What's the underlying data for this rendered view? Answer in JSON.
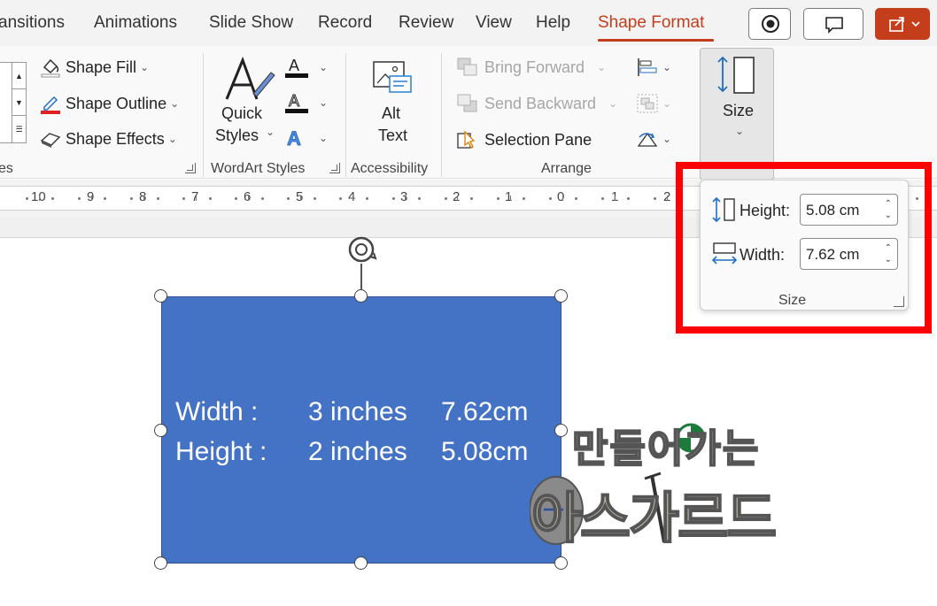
{
  "tabs": [
    {
      "label": "ansitions"
    },
    {
      "label": "Animations"
    },
    {
      "label": "Slide Show"
    },
    {
      "label": "Record"
    },
    {
      "label": "Review"
    },
    {
      "label": "View"
    },
    {
      "label": "Help"
    },
    {
      "label": "Shape Format",
      "active": true
    }
  ],
  "ribbon": {
    "shape_styles": {
      "fill": "Shape Fill",
      "outline": "Shape Outline",
      "effects": "Shape Effects",
      "group_label_fragment": "es"
    },
    "wordart": {
      "quick_styles_line1": "Quick",
      "quick_styles_line2": "Styles",
      "group_label": "WordArt Styles"
    },
    "accessibility": {
      "alt_line1": "Alt",
      "alt_line2": "Text",
      "group_label": "Accessibility"
    },
    "arrange": {
      "bring_forward": "Bring Forward",
      "send_backward": "Send Backward",
      "selection_pane": "Selection Pane",
      "group_label": "Arrange"
    },
    "size_button": "Size"
  },
  "ruler": [
    "10",
    "9",
    "8",
    "7",
    "6",
    "5",
    "4",
    "3",
    "2",
    "1",
    "0",
    "1",
    "2"
  ],
  "size_popup": {
    "height_label": "Height:",
    "height_value": "5.08 cm",
    "width_label": "Width:",
    "width_value": "7.62 cm",
    "group_label": "Size"
  },
  "shape": {
    "line1_label": "Width :",
    "line1_inches": "3 inches",
    "line1_cm": "7.62cm",
    "line2_label": "Height :",
    "line2_inches": "2 inches",
    "line2_cm": "5.08cm"
  },
  "watermark": {
    "line1": "만들어가는",
    "line2": "아스가르드"
  },
  "colors": {
    "accent": "#c43e1c",
    "shape_fill": "#4472c4",
    "highlight": "#ff0000"
  }
}
